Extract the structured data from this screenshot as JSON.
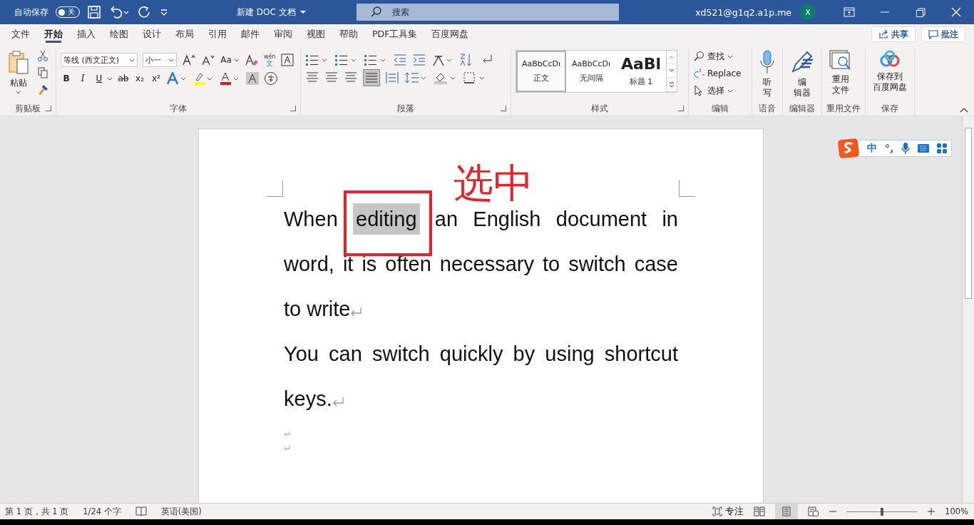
{
  "title_bar": {
    "autosave_label": "自动保存",
    "autosave": {
      "on": false,
      "label": "关"
    },
    "doc_title": "新建 DOC 文档",
    "search": {
      "placeholder": "搜索"
    },
    "account": "xd521@g1q2.a1p.me",
    "avatar": "X"
  },
  "tabs": [
    {
      "label": "文件",
      "selected": false
    },
    {
      "label": "开始",
      "selected": true
    },
    {
      "label": "插入",
      "selected": false
    },
    {
      "label": "绘图",
      "selected": false
    },
    {
      "label": "设计",
      "selected": false
    },
    {
      "label": "布局",
      "selected": false
    },
    {
      "label": "引用",
      "selected": false
    },
    {
      "label": "邮件",
      "selected": false
    },
    {
      "label": "审阅",
      "selected": false
    },
    {
      "label": "视图",
      "selected": false
    },
    {
      "label": "帮助",
      "selected": false
    },
    {
      "label": "PDF工具集",
      "selected": false
    },
    {
      "label": "百度网盘",
      "selected": false
    }
  ],
  "share_button": "共享",
  "comment_button": "批注",
  "ribbon": {
    "clipboard": {
      "paste": "粘贴",
      "label": "剪贴板"
    },
    "font": {
      "font_name": "等线 (西文正文)",
      "font_size": "小一",
      "case_button": "Aa",
      "phonetic_top": "wén",
      "phonetic_bottom": "文",
      "bold": "B",
      "italic": "I",
      "underline": "U",
      "strike": "ab",
      "subscript": "x₂",
      "superscript": "x²",
      "label": "字体"
    },
    "paragraph": {
      "label": "段落"
    },
    "styles": {
      "items": [
        {
          "preview": "AaBbCcDı",
          "name": "正文",
          "kind": "normal",
          "selected": true
        },
        {
          "preview": "AaBbCcDı",
          "name": "无间隔",
          "kind": "normal",
          "selected": false
        },
        {
          "preview": "AaBl",
          "name": "标题 1",
          "kind": "heading",
          "selected": false
        }
      ],
      "label": "样式"
    },
    "editing": {
      "find": "查找",
      "replace": "Replace",
      "select": "选择",
      "label": "编辑"
    },
    "voice": {
      "button": [
        "听",
        "写"
      ],
      "label": "语音"
    },
    "editor": {
      "button": [
        "编",
        "辑器"
      ],
      "label": "编辑器"
    },
    "reuse": {
      "button": [
        "重用",
        "文件"
      ],
      "label": "重用文件"
    },
    "save": {
      "button": [
        "保存到",
        "百度网盘"
      ],
      "label": "保存"
    }
  },
  "document": {
    "paragraphs": [
      {
        "segments": [
          {
            "text": "When ",
            "selected": false
          },
          {
            "text": "editing",
            "selected": true
          },
          {
            "text": " an English document in word, it is often necessary to switch case to write",
            "selected": false
          }
        ]
      },
      {
        "segments": [
          {
            "text": "You can switch quickly by using shortcut keys.",
            "selected": false
          }
        ]
      }
    ],
    "annotation": "选中"
  },
  "ime_bar": {
    "mode": "中",
    "punct": "°,"
  },
  "status_bar": {
    "page": "第 1 页，共 1 页",
    "words": "1/24 个字",
    "language": "英语(美国)",
    "focus": "专注",
    "zoom": "100%",
    "level": 0.5
  }
}
